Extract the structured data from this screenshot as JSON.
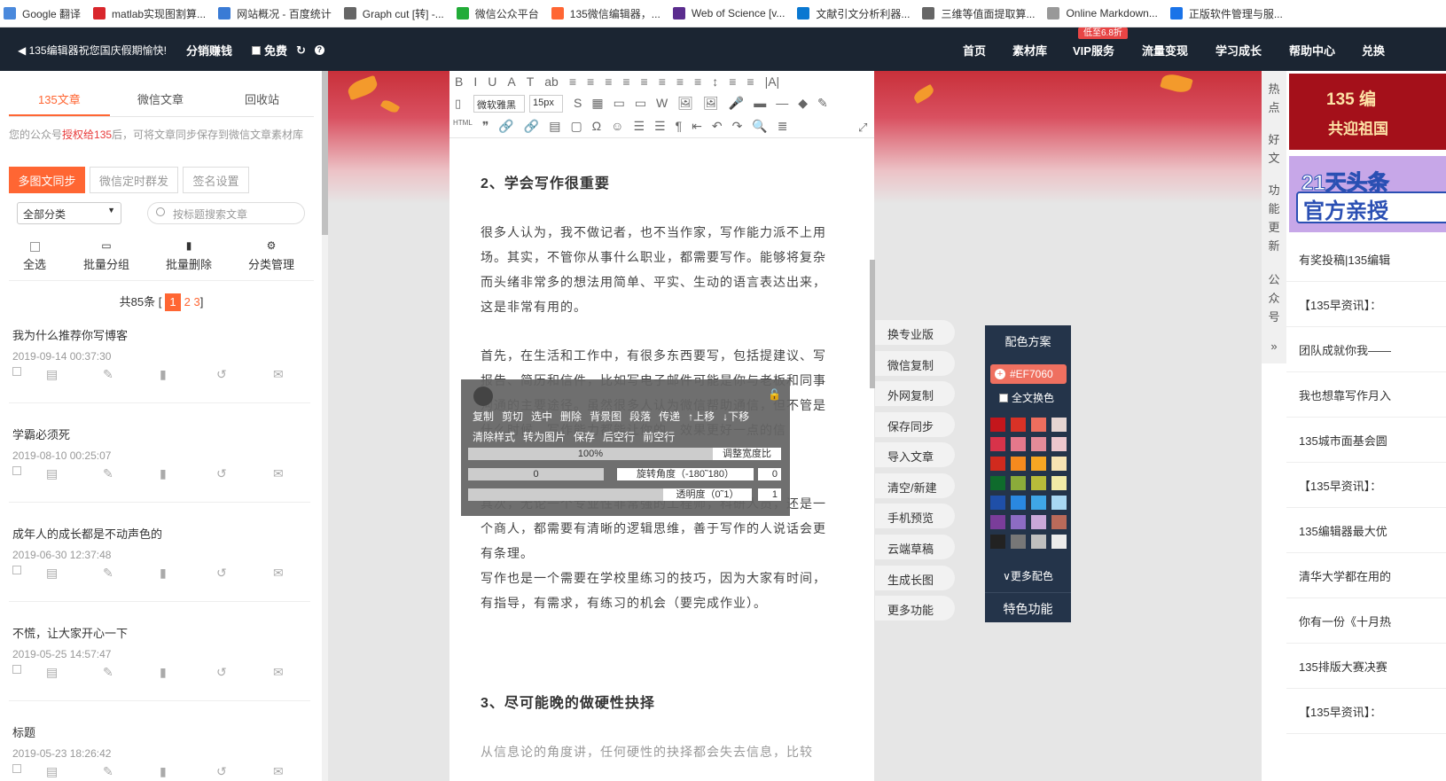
{
  "bookmarks": [
    {
      "label": "Google 翻译",
      "color": "#4a89dc"
    },
    {
      "label": "matlab实现图割算...",
      "color": "#d9262c"
    },
    {
      "label": "网站概况 - 百度统计",
      "color": "#3a7bd5"
    },
    {
      "label": "Graph cut [转] -...",
      "color": "#666666"
    },
    {
      "label": "微信公众平台",
      "color": "#22ac38"
    },
    {
      "label": "135微信编辑器，...",
      "color": "#ff6633"
    },
    {
      "label": "Web of Science [v...",
      "color": "#5b2d8e"
    },
    {
      "label": "文献引文分析利器...",
      "color": "#0a78d1"
    },
    {
      "label": "三维等值面提取算...",
      "color": "#666666"
    },
    {
      "label": "Online Markdown...",
      "color": "#999999"
    },
    {
      "label": "正版软件管理与服...",
      "color": "#1a73e8"
    }
  ],
  "topnav": {
    "notice": "◀ 135编辑器祝您国庆假期愉快!",
    "earn": "分销赚钱",
    "free": "免费",
    "refresh_icon": "↻",
    "help_icon": "?",
    "items": [
      "首页",
      "素材库",
      "VIP服务",
      "流量变现",
      "学习成长",
      "帮助中心",
      "兑换"
    ],
    "vip_badge": "低至6.8折"
  },
  "left": {
    "tabs": [
      "135文章",
      "微信文章",
      "回收站"
    ],
    "auth_prefix": "您的公众号",
    "auth_link": "授权给135",
    "auth_suffix": "后，可将文章同步保存到微信文章素材库",
    "buttons": [
      "多图文同步",
      "微信定时群发",
      "签名设置"
    ],
    "category": "全部分类",
    "search_placeholder": "按标题搜索文章",
    "ops": [
      {
        "icon": "☐",
        "label": "全选"
      },
      {
        "icon": "📂",
        "label": "批量分组"
      },
      {
        "icon": "🗑",
        "label": "批量删除"
      },
      {
        "icon": "⚙",
        "label": "分类管理"
      }
    ],
    "pager": {
      "prefix": "共85条 [",
      "current": "1",
      "others": "2 3",
      "suffix": "]"
    },
    "articles": [
      {
        "title": "我为什么推荐你写博客",
        "date": "2019-09-14 00:37:30"
      },
      {
        "title": "学霸必须死",
        "date": "2019-08-10 00:25:07"
      },
      {
        "title": "成年人的成长都是不动声色的",
        "date": "2019-06-30 12:37:48"
      },
      {
        "title": "不慌，让大家开心一下",
        "date": "2019-05-25 14:57:47"
      },
      {
        "title": "标题",
        "date": "2019-05-23 18:26:42"
      }
    ]
  },
  "toolbar": {
    "row1": [
      "B",
      "I",
      "U",
      "A",
      "T",
      "ab",
      "≡",
      "≡",
      "≡",
      "≡",
      "≡",
      "≡",
      "≡",
      "≡",
      "↕",
      "≡",
      "≡",
      "|A|"
    ],
    "font": "微软雅黑",
    "size": "15px",
    "row2": [
      "S",
      "▦",
      "▭",
      "▭",
      "W",
      "🖼",
      "🖼",
      "🎤",
      "▬",
      "—",
      "◆",
      "✎"
    ],
    "row3": [
      "HTML",
      "❞",
      "🔗",
      "🔗",
      "▤",
      "▢",
      "Ω",
      "☺",
      "☰",
      "☰",
      "¶",
      "⇤",
      "↶",
      "↷",
      "🔍",
      "≣"
    ],
    "expand": "⤢"
  },
  "content": {
    "h1": "2、学会写作很重要",
    "p1": "很多人认为，我不做记者，也不当作家，写作能力派不上用场。其实，不管你从事什么职业，都需要写作。能够将复杂而头绪非常多的想法用简单、平实、生动的语言表达出来，这是非常有用的。",
    "p2": "首先，在生活和工作中，有很多东西要写，包括提建议、写报告、简历和信件，比如写电子邮件可能是你与老板和同事沟通的主要途径。虽然很多人认为微信帮助通信，但不管是什么时候，写作能力都能让你的，效果更好一点的信",
    "p3": "其次，无论一个专业性非常强的工程师，科研人员，还是一个商人，都需要有清晰的逻辑思维，善于写作的人说话会更有条理。",
    "p4": "写作也是一个需要在学校里练习的技巧，因为大家有时间，有指导，有需求，有练习的机会（要完成作业）。",
    "h2": "3、尽可能晚的做硬性抉择",
    "p5": "从信息论的角度讲，任何硬性的抉择都会失去信息，比较"
  },
  "image_popup": {
    "row1": [
      "复制",
      "剪切",
      "选中",
      "删除",
      "背景图",
      "段落",
      "传递",
      "↑上移",
      "↓下移"
    ],
    "row2": [
      "清除样式",
      "转为图片",
      "保存",
      "后空行",
      "前空行"
    ],
    "width_value": "100%",
    "width_label": "调整宽度比",
    "rotate_value": "0",
    "rotate_label": "旋转角度（-180˜180）",
    "rotate_input": "0",
    "opacity_label": "透明度（0˜1）",
    "opacity_input": "1"
  },
  "side_buttons": [
    "换专业版",
    "微信复制",
    "外网复制",
    "保存同步",
    "导入文章",
    "清空/新建",
    "手机预览",
    "云端草稿",
    "生成长图",
    "更多功能"
  ],
  "color_panel": {
    "title": "配色方案",
    "hex": "#EF7060",
    "all_label": "全文换色",
    "swatches": [
      "#c3161c",
      "#d93226",
      "#ee6e5e",
      "#e6d5d2",
      "#d8334a",
      "#e5788b",
      "#e38b98",
      "#ecc6cd",
      "#d12a1e",
      "#f68a1e",
      "#f6a623",
      "#f6e3b2",
      "#0f6b2c",
      "#8bab3a",
      "#b7bb3a",
      "#f0eaa6",
      "#1f4fa8",
      "#2a88e0",
      "#3fa6e6",
      "#a8d7f2",
      "#7a3d9a",
      "#8d6cc3",
      "#c9a8d8",
      "#b96a5a",
      "#222222",
      "#777777",
      "#bfbfbf",
      "#ececec"
    ],
    "more": "∨更多配色",
    "feature": "特色功能"
  },
  "right_tabs": [
    "热",
    "点",
    "好",
    "文",
    "功",
    "能",
    "更",
    "新",
    "公",
    "众",
    "号",
    "»"
  ],
  "right": {
    "banner1_line1": "135 编",
    "banner1_line2": "共迎祖国",
    "banner2_line1": "21天头条",
    "banner2_line2": "官方亲授",
    "news": [
      "有奖投稿|135编辑",
      "【135早资讯】：",
      "团队成就你我——",
      "我也想靠写作月入",
      "135城市面基会圆",
      "【135早资讯】：",
      "135编辑器最大优",
      "清华大学都在用的",
      "你有一份《十月热",
      "135排版大赛决赛",
      "【135早资讯】："
    ]
  }
}
